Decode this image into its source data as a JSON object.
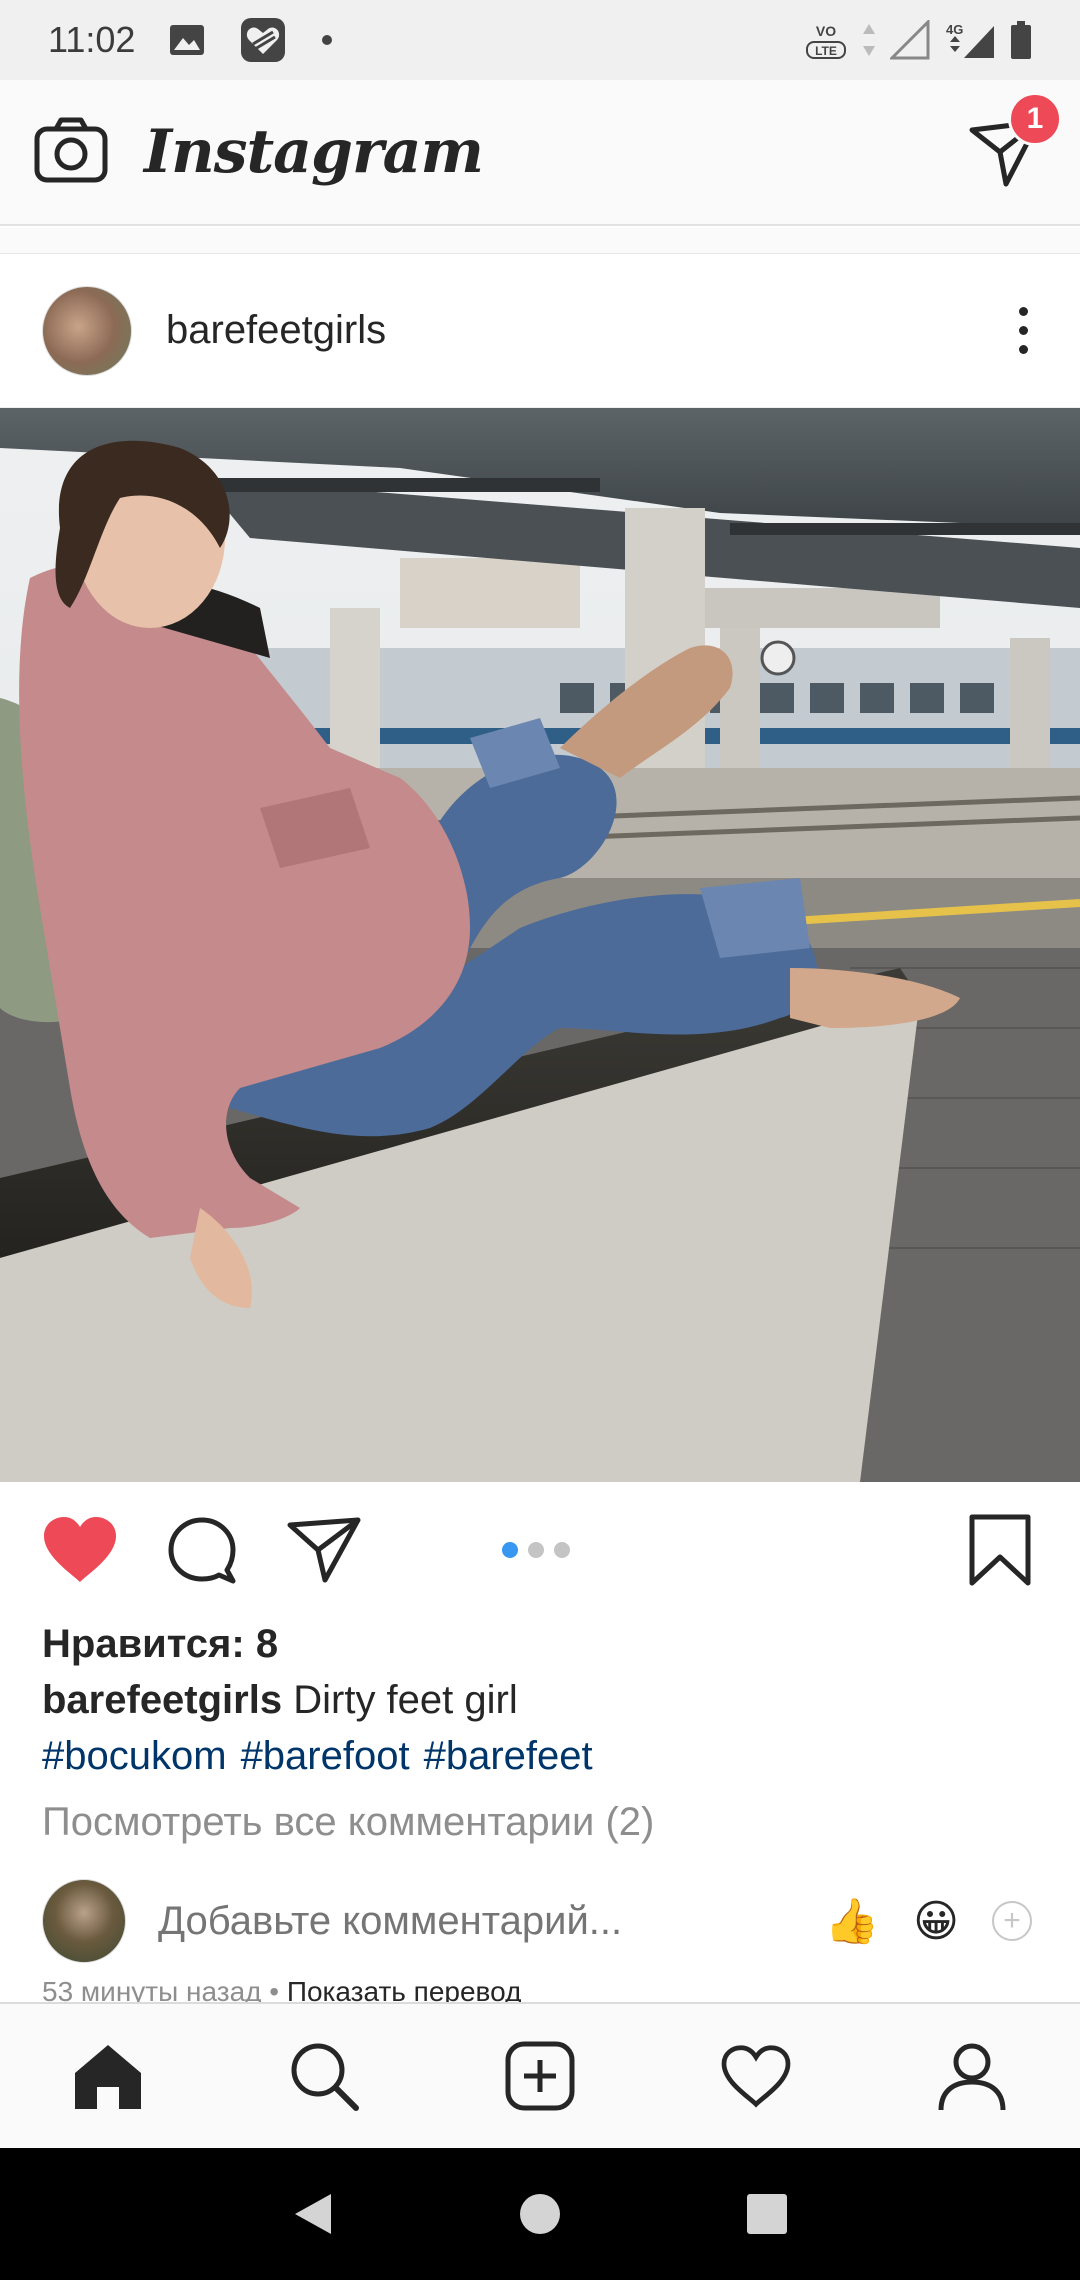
{
  "status_bar": {
    "time": "11:02",
    "network": "4G",
    "volte": "VoLTE"
  },
  "header": {
    "app_name": "Instagram",
    "dm_badge_count": "1"
  },
  "post": {
    "username": "barefeetgirls",
    "carousel": {
      "total": 3,
      "active_index": 0
    },
    "likes_text": "Нравится: 8",
    "caption_user": "barefeetgirls",
    "caption_text": "Dirty feet girl",
    "hashtags": [
      "#bocukom",
      "#barefoot",
      "#barefeet"
    ],
    "view_comments": "Посмотреть все комментарии (2)",
    "comment_placeholder": "Добавьте комментарий...",
    "quick_emojis": [
      "👍",
      "😀"
    ],
    "time_ago": "53 минуты назад",
    "separator": "•",
    "translate_link": "Показать перевод"
  },
  "bottom_nav": {
    "items": [
      "home",
      "search",
      "new-post",
      "activity",
      "profile"
    ],
    "active": "home"
  },
  "colors": {
    "like_red": "#ed4956",
    "link_blue": "#003569",
    "active_dot": "#3897f0",
    "muted_text": "#8e8e8e"
  }
}
